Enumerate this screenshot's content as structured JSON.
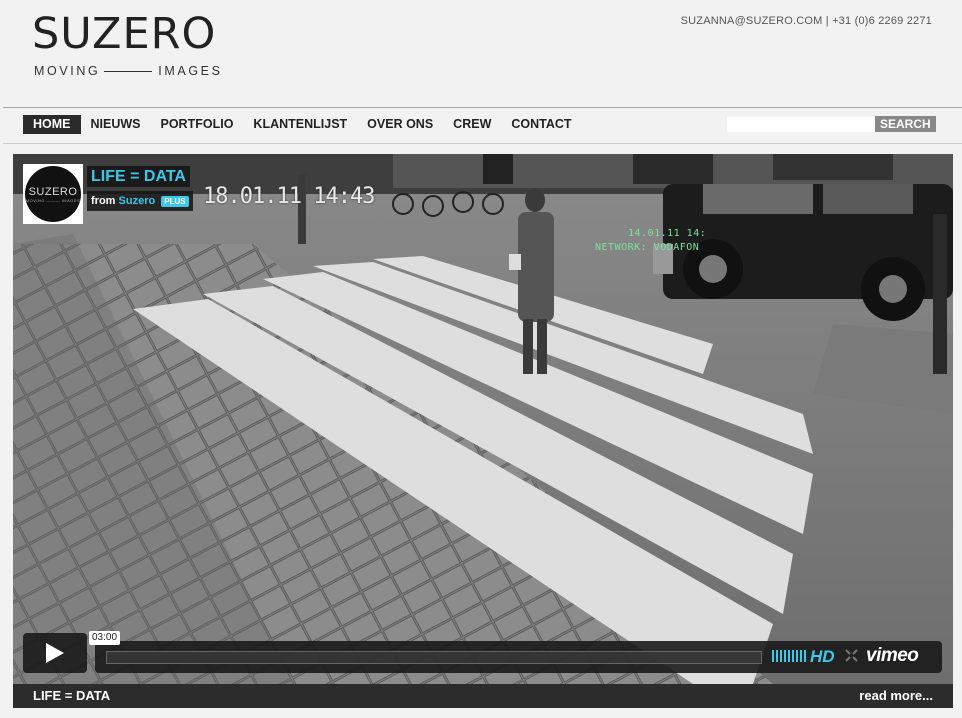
{
  "header": {
    "logo_main": "SUZERO",
    "logo_sub_left": "MOVING",
    "logo_sub_right": "IMAGES",
    "contact": "SUZANNA@SUZERO.COM | +31 (0)6 2269 2271"
  },
  "nav": {
    "items": [
      {
        "label": "HOME",
        "active": true
      },
      {
        "label": "NIEUWS"
      },
      {
        "label": "PORTFOLIO"
      },
      {
        "label": "KLANTENLIJST"
      },
      {
        "label": "OVER ONS"
      },
      {
        "label": "CREW"
      },
      {
        "label": "CONTACT"
      }
    ],
    "search_value": "",
    "search_button": "SEARCH"
  },
  "video": {
    "channel_logo_main": "SUZERO",
    "channel_logo_sub": "MOVING ——— IMAGES",
    "title": "LIFE = DATA",
    "from_label": "from",
    "from_brand": "Suzero",
    "plus_badge": "PLUS",
    "timestamp": "18.01.11 14:43",
    "overlay_line1": "14.01.11 14:",
    "overlay_line2": "NETWORK: VODAFON",
    "duration": "03:00",
    "hd_label": "HD",
    "vimeo_label": "vimeo",
    "progress": 0
  },
  "caption": {
    "title": "LIFE = DATA",
    "read_more": "read more..."
  },
  "colors": {
    "accent": "#3ec7e8",
    "nav_active_bg": "#2a2a2a",
    "caption_bg": "#2c2c2c"
  }
}
